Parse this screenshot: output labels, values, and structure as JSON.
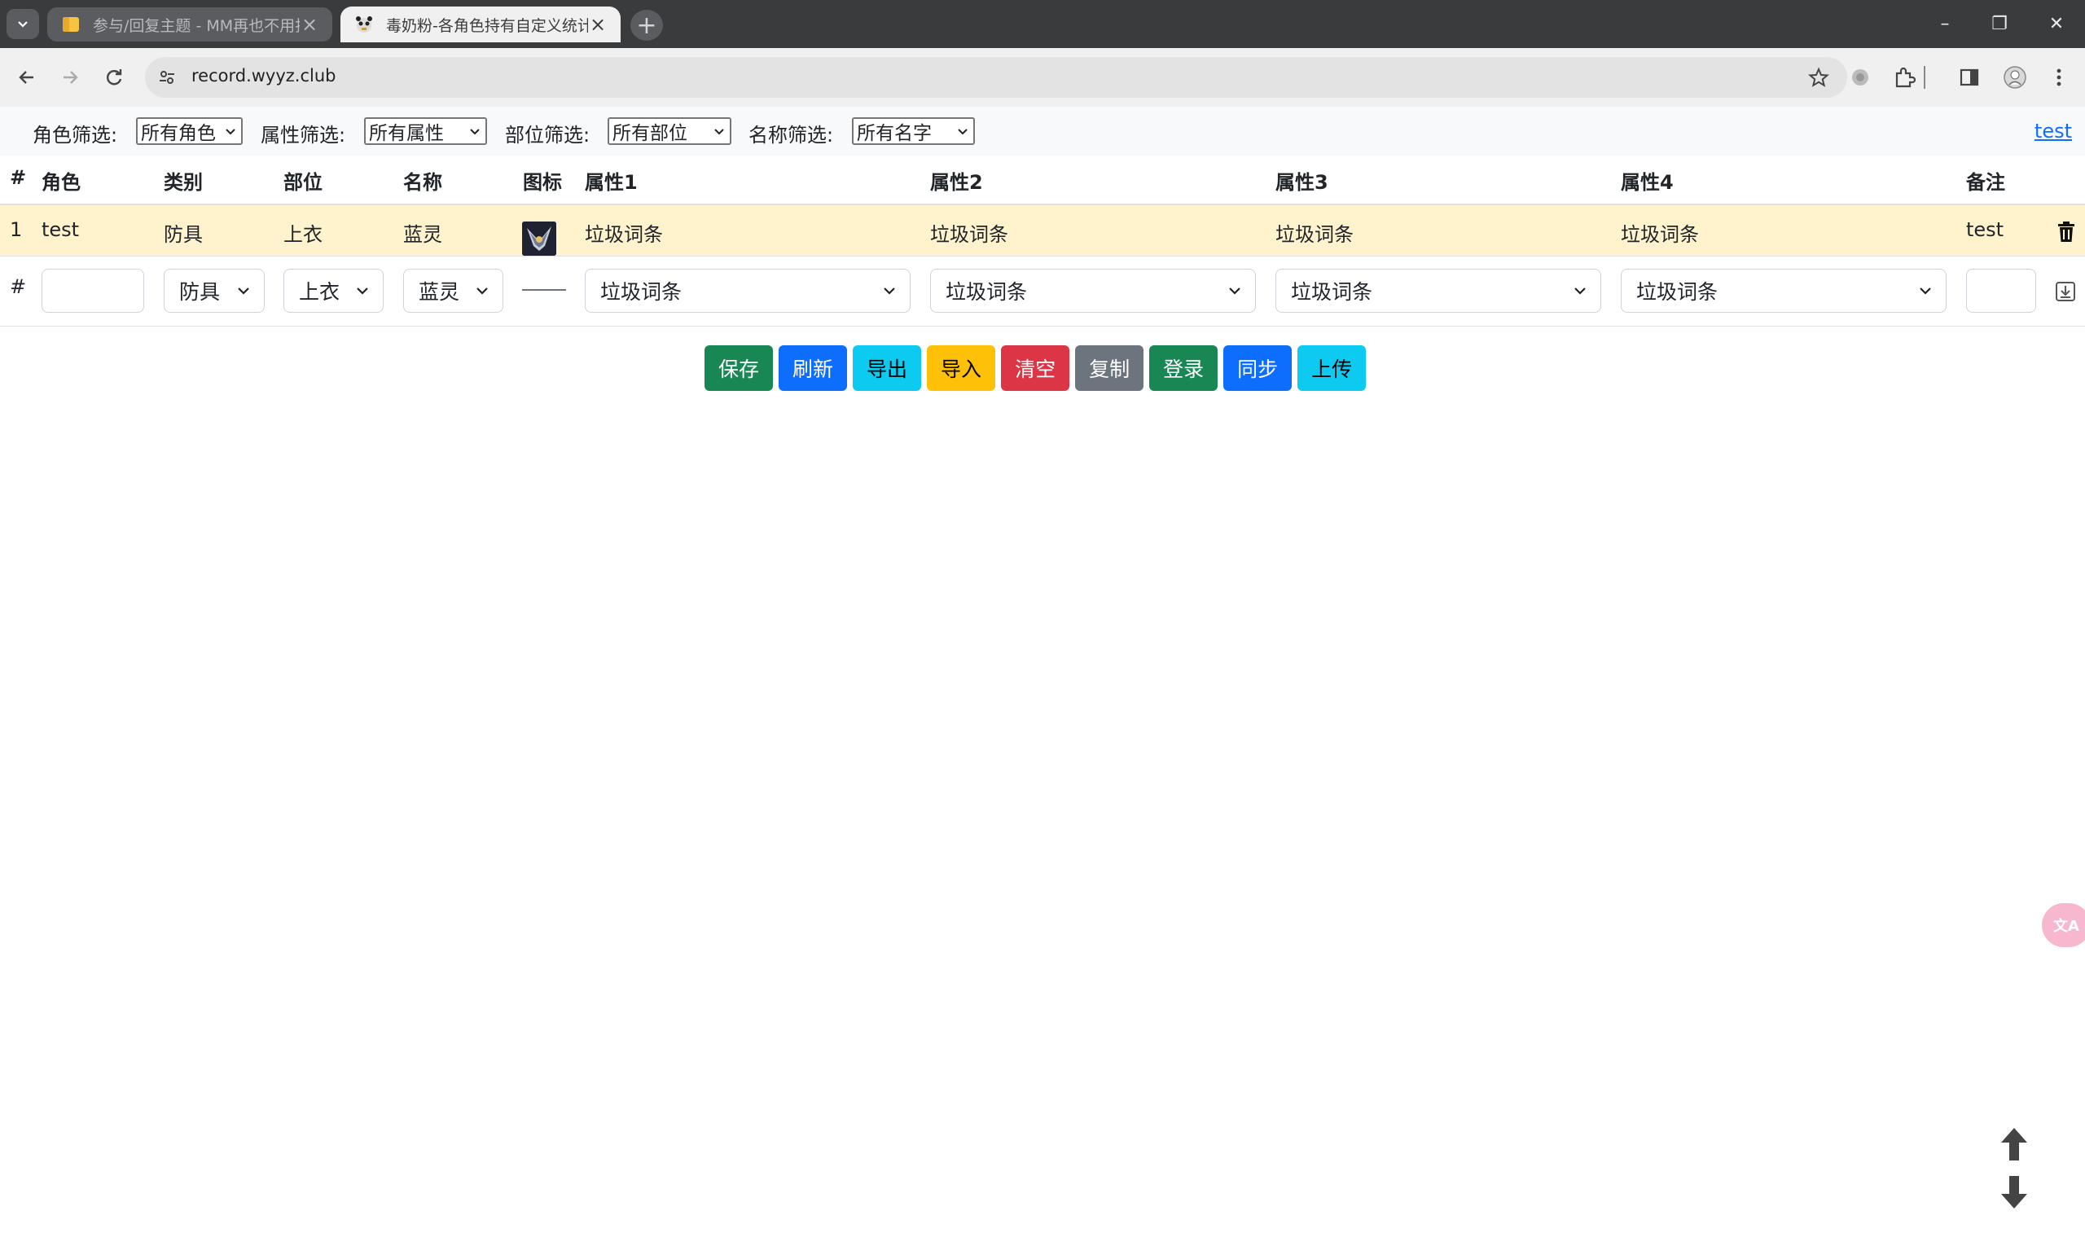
{
  "browser": {
    "tabs": [
      {
        "title": "参与/回复主题 - MM再也不用担",
        "active": false
      },
      {
        "title": "毒奶粉-各角色持有自定义统计",
        "active": true
      }
    ],
    "new_tab_label": "+",
    "url": "record.wyyz.club",
    "window_controls": {
      "minimize": "–",
      "maximize": "❐",
      "close": "✕"
    }
  },
  "filters": [
    {
      "label": "角色筛选:",
      "value": "所有角色"
    },
    {
      "label": "属性筛选:",
      "value": "所有属性"
    },
    {
      "label": "部位筛选:",
      "value": "所有部位"
    },
    {
      "label": "名称筛选:",
      "value": "所有名字"
    }
  ],
  "user_link": "test",
  "table": {
    "headers": [
      "#",
      "角色",
      "类别",
      "部位",
      "名称",
      "图标",
      "属性1",
      "属性2",
      "属性3",
      "属性4",
      "备注"
    ],
    "rows": [
      {
        "index": "1",
        "role": "test",
        "category": "防具",
        "slot": "上衣",
        "name": "蓝灵",
        "icon": "item-icon",
        "attr1": "垃圾词条",
        "attr2": "垃圾词条",
        "attr3": "垃圾词条",
        "attr4": "垃圾词条",
        "note": "test"
      }
    ],
    "row_highlight_color": "#fff3cd"
  },
  "input_row": {
    "index": "#",
    "role_value": "",
    "category": "防具",
    "slot": "上衣",
    "name": "蓝灵",
    "icon_placeholder": "——",
    "attr1": "垃圾词条",
    "attr2": "垃圾词条",
    "attr3": "垃圾词条",
    "attr4": "垃圾词条",
    "note_value": ""
  },
  "buttons": [
    {
      "label": "保存",
      "color": "#198754",
      "text_color": "#ffffff"
    },
    {
      "label": "刷新",
      "color": "#0d6efd",
      "text_color": "#ffffff"
    },
    {
      "label": "导出",
      "color": "#0dcaf0",
      "text_color": "#000000"
    },
    {
      "label": "导入",
      "color": "#ffc107",
      "text_color": "#000000"
    },
    {
      "label": "清空",
      "color": "#dc3545",
      "text_color": "#ffffff"
    },
    {
      "label": "复制",
      "color": "#6c757d",
      "text_color": "#ffffff"
    },
    {
      "label": "登录",
      "color": "#198754",
      "text_color": "#ffffff"
    },
    {
      "label": "同步",
      "color": "#0d6efd",
      "text_color": "#ffffff"
    },
    {
      "label": "上传",
      "color": "#0dcaf0",
      "text_color": "#000000"
    }
  ],
  "floating": {
    "translate_label": "文A",
    "scroll_up": "arrow-up-icon",
    "scroll_down": "arrow-down-icon"
  }
}
